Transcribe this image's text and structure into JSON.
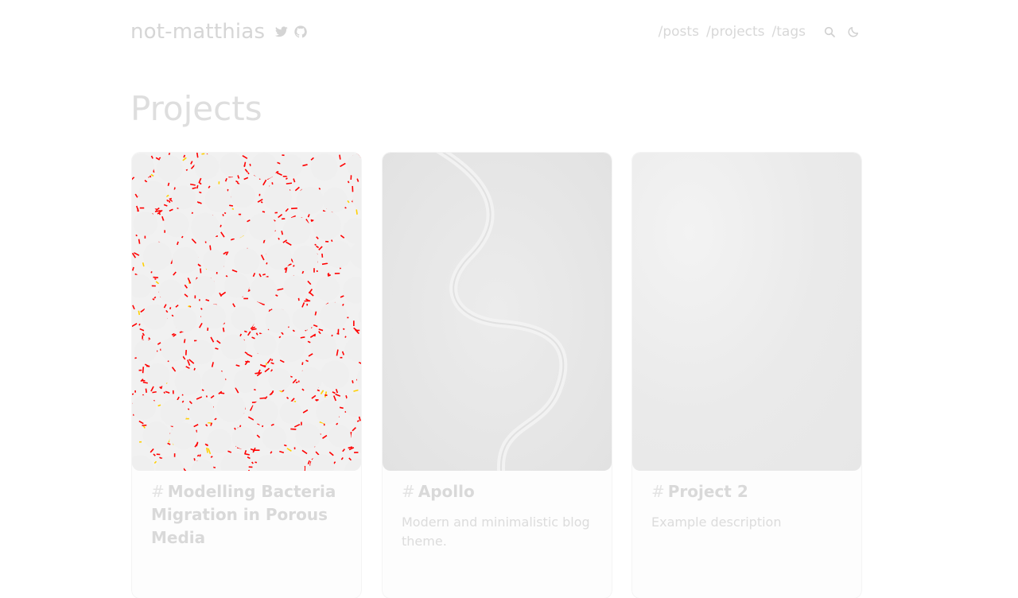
{
  "site": {
    "name": "not-matthias",
    "social": [
      {
        "icon": "twitter-icon"
      },
      {
        "icon": "github-icon"
      }
    ]
  },
  "nav": {
    "links": [
      "/posts",
      "/projects",
      "/tags"
    ],
    "tools": [
      {
        "icon": "search-icon"
      },
      {
        "icon": "moon-icon"
      }
    ]
  },
  "page": {
    "title": "Projects"
  },
  "projects": [
    {
      "hash": "#",
      "title": "Modelling Bacteria Migration in Porous Media",
      "description": "",
      "image": "bacteria-simulation-image"
    },
    {
      "hash": "#",
      "title": "Apollo",
      "description": "Modern and minimalistic blog theme.",
      "image": "forest-road-aerial-image"
    },
    {
      "hash": "#",
      "title": "Project 2",
      "description": "Example description",
      "image": "soft-gradient-image"
    }
  ],
  "colors": {
    "text_faded": "#d6d6d6",
    "bacteria": "#ff0000",
    "bacteria_accent": "#ffd000"
  }
}
